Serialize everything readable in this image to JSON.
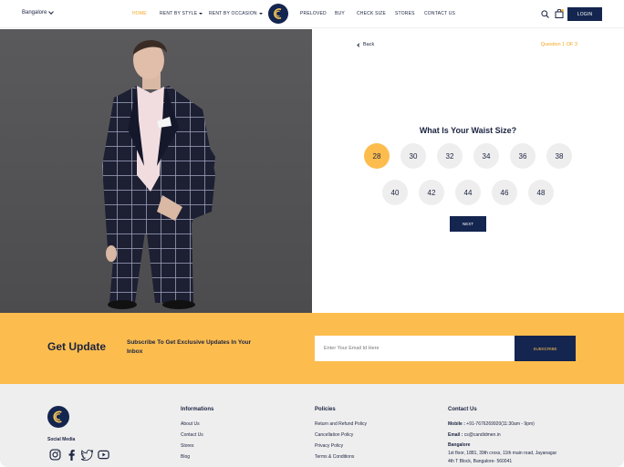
{
  "header": {
    "city": "Bangalore",
    "nav": [
      {
        "label": "HOME",
        "active": true
      },
      {
        "label": "RENT BY STYLE",
        "dropdown": true
      },
      {
        "label": "RENT BY OCCASION",
        "dropdown": true
      },
      {
        "label": "PRELOVED"
      },
      {
        "label": "BUY"
      },
      {
        "label": "CHECK SIZE"
      },
      {
        "label": "STORES"
      },
      {
        "label": "CONTACT US"
      }
    ],
    "login_label": "LOGIN",
    "icons": {
      "search": "search-icon",
      "bag": "shopping-bag-icon",
      "logo": "brand-logo"
    }
  },
  "quiz": {
    "back_label": "Back",
    "question_count": "Question 1 OF 3",
    "question": "What Is Your Waist Size?",
    "sizes": [
      "28",
      "30",
      "32",
      "34",
      "36",
      "38",
      "40",
      "42",
      "44",
      "46",
      "48"
    ],
    "selected": "28",
    "next_label": "NEXT"
  },
  "update": {
    "title": "Get Update",
    "subtitle": "Subscribe To Get Exclusive Updates In Your Inbox",
    "email_placeholder": "Enter Your Email Id Here",
    "subscribe_label": "SUBSCRIBE"
  },
  "footer": {
    "social_label": "Social Media",
    "social_icons": [
      "instagram-icon",
      "facebook-icon",
      "twitter-icon",
      "youtube-icon"
    ],
    "informations": {
      "title": "Informations",
      "links": [
        "About Us",
        "Contact Us",
        "Stores",
        "Blog"
      ]
    },
    "policies": {
      "title": "Policies",
      "links": [
        "Return and Refund Policy",
        "Cancellation Policy",
        "Privacy Policy",
        "Terms & Conditions"
      ]
    },
    "contact": {
      "title": "Contact Us",
      "mobile_label": "Mobile :",
      "mobile": "+91-7676269920(11:30am - 9pm)",
      "email_label": "Email :",
      "email": "cs@candidmen.in",
      "city": "Bangalore",
      "address1": "1st floor, 1881, 39th cross, 11th main road, Jayanagar",
      "address2": "4th T Block, Bangalore- 560041"
    }
  },
  "colors": {
    "accent": "#fdbd4e",
    "navy": "#14254f",
    "highlight": "#f6a623"
  }
}
